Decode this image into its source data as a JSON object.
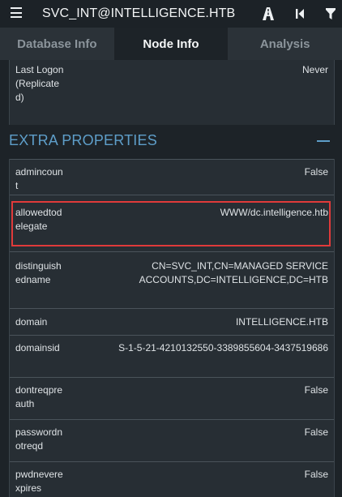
{
  "header": {
    "title": "SVC_INT@INTELLIGENCE.HTB",
    "icons": [
      "menu-icon",
      "path-finding-icon",
      "back-icon",
      "filter-icon"
    ]
  },
  "tabs": [
    {
      "label": "Database Info",
      "active": false
    },
    {
      "label": "Node Info",
      "active": true
    },
    {
      "label": "Analysis",
      "active": false
    }
  ],
  "top_rows": [
    {
      "key": "Last Logon (Replicated)",
      "value": "Never"
    }
  ],
  "extra_properties": {
    "title": "EXTRA PROPERTIES",
    "collapse_icon": "minus-icon",
    "rows": [
      {
        "key": "admincount",
        "value": "False"
      },
      {
        "key": "allowedtodelegate",
        "value": "WWW/dc.intelligence.htb",
        "highlighted": true
      },
      {
        "key": "distinguishedname",
        "value": "CN=SVC_INT,CN=MANAGED SERVICE ACCOUNTS,DC=INTELLIGENCE,DC=HTB"
      },
      {
        "key": "domain",
        "value": "INTELLIGENCE.HTB"
      },
      {
        "key": "domainsid",
        "value": "S-1-5-21-4210132550-3389855604-3437519686"
      },
      {
        "key": "dontreqpreauth",
        "value": "False"
      },
      {
        "key": "passwordnotreqd",
        "value": "False"
      },
      {
        "key": "pwdneverexpires",
        "value": "False"
      }
    ]
  },
  "colors": {
    "accent": "#5e9ec9",
    "highlight_border": "#e03a3a"
  }
}
